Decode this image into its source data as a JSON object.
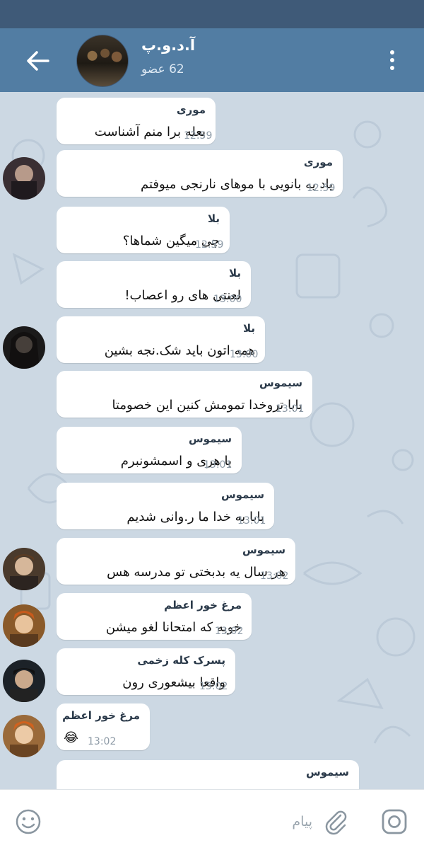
{
  "header": {
    "title": "آ.د.و.پ",
    "subtitle": "62 عضو"
  },
  "composer": {
    "placeholder": "پیام"
  },
  "messages": [
    {
      "sender": "موری",
      "text": "بعله برا منم آشناست",
      "time": "12:59"
    },
    {
      "sender": "موری",
      "text": "یاد یه بانویی با موهای نارنجی میوفتم",
      "time": "12:59"
    },
    {
      "sender": "بلا",
      "text": "چی میگین شماها؟",
      "time": "12:59"
    },
    {
      "sender": "بلا",
      "text": "لعنتی های رو اعصاب!",
      "time": "13:00"
    },
    {
      "sender": "بلا",
      "text": "همه اتون باید شک.نجه بشین",
      "time": "13:00"
    },
    {
      "sender": "سیموس",
      "text": "بابا تروخدا تمومش کنین این خصومتا",
      "time": "13:01"
    },
    {
      "sender": "سیموس",
      "text": "با هری و اسمشونبرم",
      "time": "13:01"
    },
    {
      "sender": "سیموس",
      "text": "بابا به خدا ما ر.وانی شدیم",
      "time": "13:01"
    },
    {
      "sender": "سیموس",
      "text": "هر سال یه بدبختی تو مدرسه هس",
      "time": "13:02"
    },
    {
      "sender": "مرغ خور اعظم",
      "text": "خوبه که امتحانا لغو میشن",
      "time": "13:02"
    },
    {
      "sender": "پسرک کله زخمی",
      "text": "واقعا بیشعوری رون",
      "time": "13:02"
    },
    {
      "sender": "مرغ خور اعظم",
      "text": "😂",
      "time": "13:02"
    },
    {
      "sender": "سیموس",
      "text": "",
      "time": ""
    }
  ]
}
